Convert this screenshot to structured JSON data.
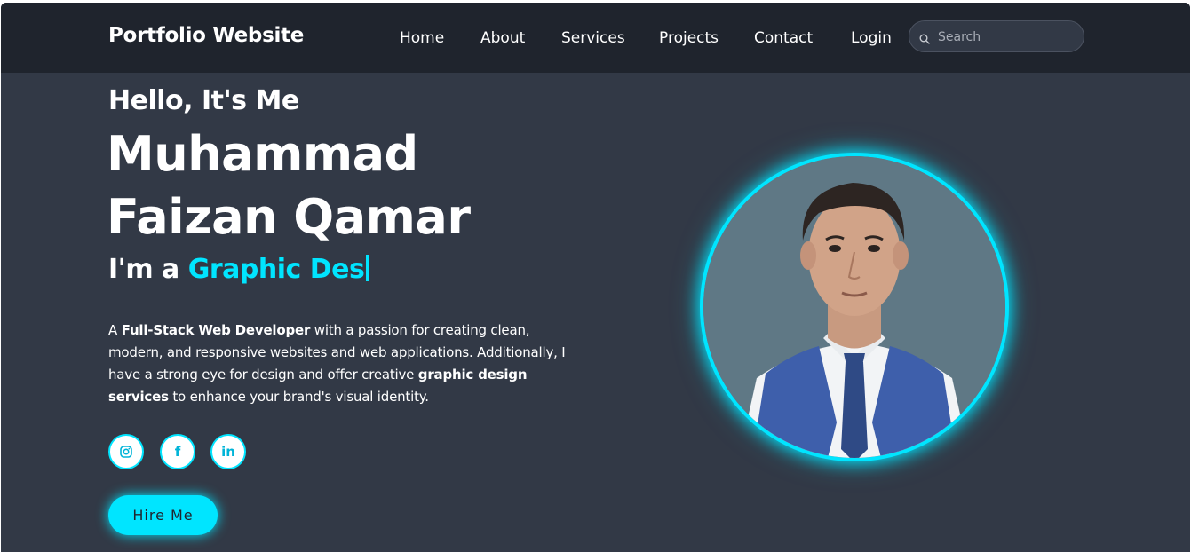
{
  "header": {
    "logo": "Portfolio Website",
    "nav": [
      {
        "label": "Home"
      },
      {
        "label": "About"
      },
      {
        "label": "Services"
      },
      {
        "label": "Projects"
      },
      {
        "label": "Contact"
      },
      {
        "label": "Login"
      }
    ],
    "search": {
      "placeholder": "Search",
      "value": "",
      "icon": "search-icon"
    }
  },
  "hero": {
    "greeting": "Hello, It's Me",
    "name_line1": "Muhammad",
    "name_line2": "Faizan Qamar",
    "role_prefix": "I'm a",
    "role_typed": "Graphic Des",
    "description": {
      "p1": "A ",
      "b1": "Full-Stack Web Developer",
      "p2": " with a passion for creating clean, modern, and responsive websites and web applications. Additionally, I have a strong eye for design and offer creative ",
      "b2": "graphic design services",
      "p3": " to enhance your brand's visual identity."
    },
    "social": [
      {
        "icon": "instagram-icon"
      },
      {
        "icon": "facebook-icon",
        "glyph": "f"
      },
      {
        "icon": "linkedin-icon",
        "glyph": "in"
      }
    ],
    "cta_label": "Hire Me",
    "profile_image": "profile-photo"
  },
  "colors": {
    "accent": "#00e5ff",
    "header_bg": "#1f242d",
    "page_bg": "#323946",
    "text": "#ffffff"
  }
}
